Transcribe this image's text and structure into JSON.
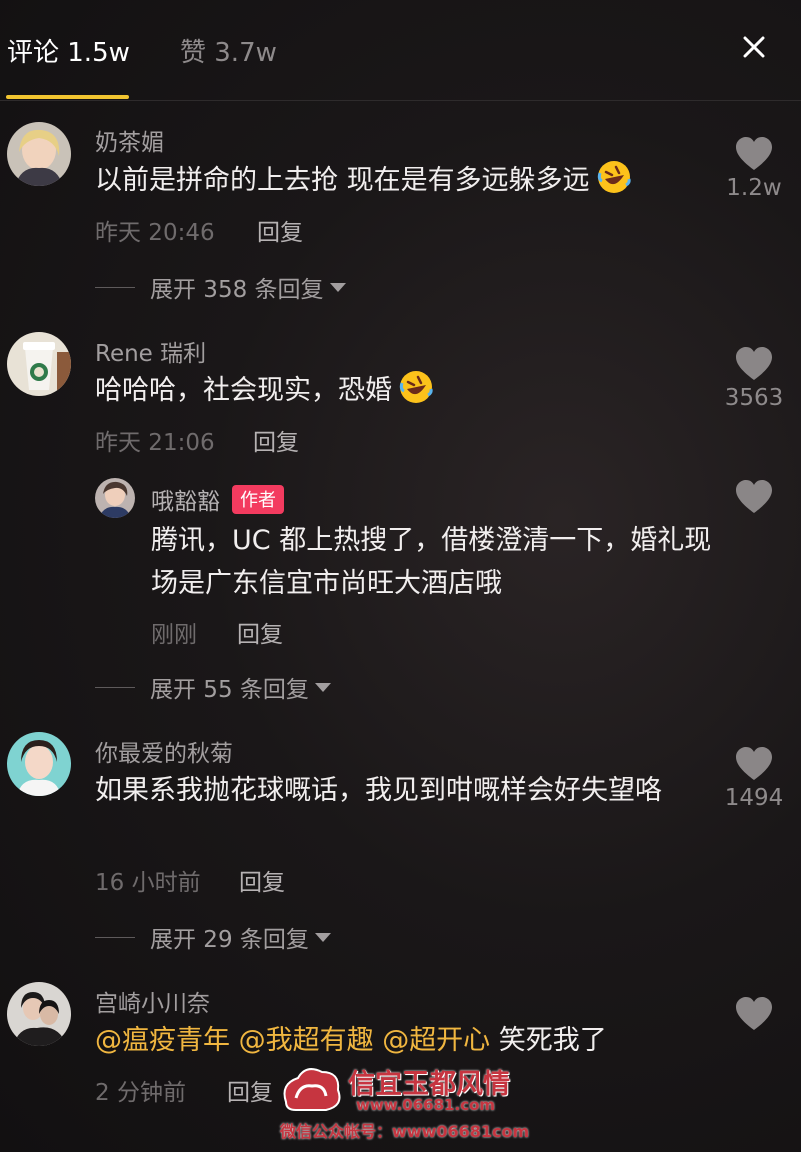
{
  "header": {
    "tabs": [
      {
        "label": "评论 1.5w",
        "active": true
      },
      {
        "label": "赞 3.7w",
        "active": false
      }
    ],
    "close_icon": "close-icon"
  },
  "comments": [
    {
      "username": "奶茶媚",
      "text": "以前是拼命的上去抢 现在是有多远躲多远",
      "emoji": "rolling-on-floor-laughing-emoji",
      "time": "昨天 20:46",
      "reply_label": "回复",
      "likes": "1.2w",
      "expand_label": "展开 358 条回复"
    },
    {
      "username": "Rene 瑞利",
      "text": "哈哈哈，社会现实，恐婚",
      "emoji": "rolling-on-floor-laughing-emoji",
      "time": "昨天 21:06",
      "reply_label": "回复",
      "likes": "3563",
      "reply": {
        "username": "哦豁豁",
        "badge": "作者",
        "text": "腾讯，UC 都上热搜了，借楼澄清一下，婚礼现场是广东信宜市尚旺大酒店哦",
        "time": "刚刚",
        "reply_label": "回复"
      },
      "expand_label": "展开 55 条回复"
    },
    {
      "username": "你最爱的秋菊",
      "text": "如果系我抛花球嘅话，我见到咁嘅样会好失望咯",
      "time": "16 小时前",
      "reply_label": "回复",
      "likes": "1494",
      "expand_label": "展开 29 条回复"
    },
    {
      "username": "宫崎小川奈",
      "mentions": [
        "@瘟疫青年",
        "@我超有趣",
        "@超开心"
      ],
      "text_after": "笑死我了",
      "time": "2 分钟前",
      "reply_label": "回复"
    }
  ],
  "watermark": {
    "title": "信宜玉都风情",
    "url": "www.06681.com",
    "subtitle": "微信公众帐号：www06681com"
  },
  "colors": {
    "accent_underline": "#f2c530",
    "author_badge": "#f33b5f",
    "mention": "#f0b640"
  }
}
